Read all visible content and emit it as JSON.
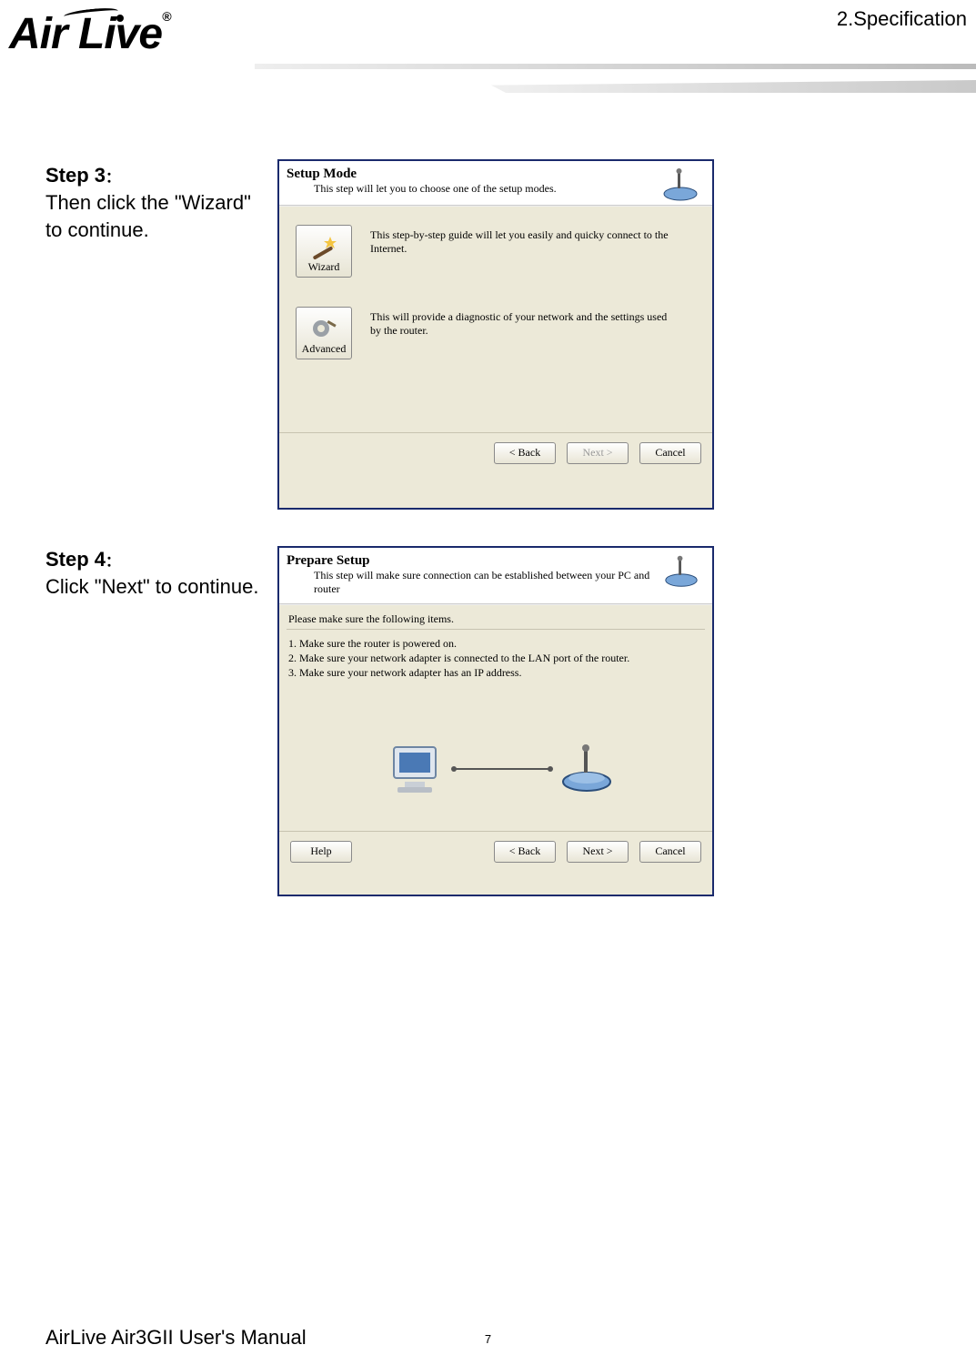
{
  "header": {
    "section": "2.Specification",
    "logo_text": "Air Live",
    "logo_reg": "®"
  },
  "step3": {
    "label": "Step 3",
    "colon": "：",
    "body": "Then click the \"Wizard\" to continue."
  },
  "step4": {
    "label": "Step 4",
    "colon": "：",
    "body": "Click \"Next\" to continue."
  },
  "dialog1": {
    "title": "Setup Mode",
    "subtitle": "This step will let you to choose one of the setup modes.",
    "wizard_btn": "Wizard",
    "wizard_desc": "This step-by-step guide will let you easily and quicky connect to the Internet.",
    "advanced_btn": "Advanced",
    "advanced_desc": "This will provide a diagnostic of your network and the settings used by the router.",
    "back": "< Back",
    "next": "Next >",
    "cancel": "Cancel"
  },
  "dialog2": {
    "title": "Prepare Setup",
    "subtitle": "This step will make sure connection can be established between your PC and router",
    "intro": "Please make sure the following items.",
    "item1": "1. Make sure the router is powered on.",
    "item2": "2. Make sure your network adapter is connected to the LAN port of the router.",
    "item3": "3. Make sure your network adapter has an IP address.",
    "help": "Help",
    "back": "< Back",
    "next": "Next >",
    "cancel": "Cancel"
  },
  "footer": {
    "manual": "AirLive Air3GII User's Manual",
    "page": "7"
  }
}
